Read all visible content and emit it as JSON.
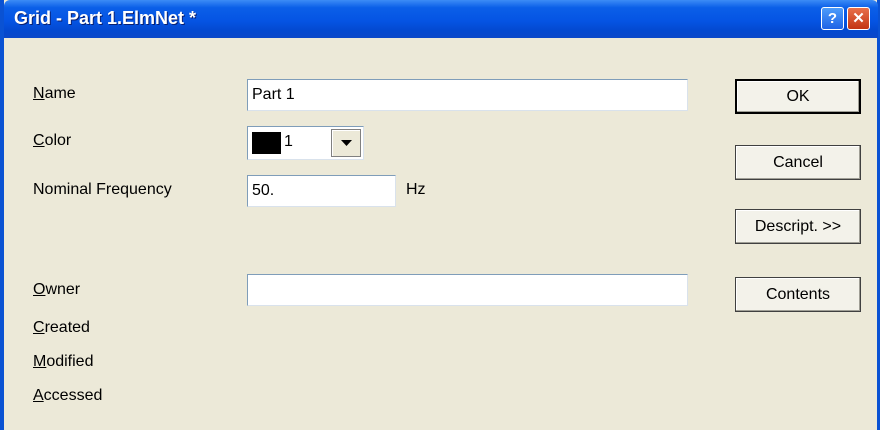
{
  "window": {
    "title": "Grid - Part 1.ElmNet *",
    "help_glyph": "?",
    "close_glyph": "✕"
  },
  "form": {
    "name": {
      "accel": "N",
      "rest": "ame",
      "value": "Part 1"
    },
    "color": {
      "accel": "C",
      "rest": "olor",
      "value": "1",
      "swatch_color": "#000000"
    },
    "nominal_frequency": {
      "label": "Nominal Frequency",
      "value": "50.",
      "unit": "Hz"
    },
    "owner": {
      "accel": "O",
      "rest": "wner",
      "value": ""
    },
    "created": {
      "accel": "C",
      "rest": "reated"
    },
    "modified": {
      "accel": "M",
      "rest": "odified"
    },
    "accessed": {
      "accel": "A",
      "rest": "ccessed"
    }
  },
  "buttons": {
    "ok": "OK",
    "cancel": "Cancel",
    "descript": "Descript. >>",
    "contents": "Contents"
  },
  "colors": {
    "titlebar": "#0554e3",
    "window_bg": "#ece9d8",
    "border": "#0a52d3"
  }
}
